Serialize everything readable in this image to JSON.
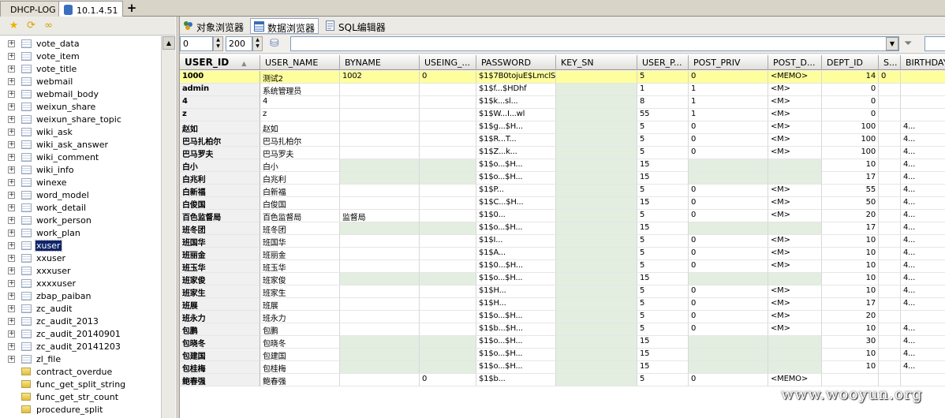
{
  "tabs": {
    "items": [
      {
        "label": "DHCP-LOG",
        "active": false
      },
      {
        "label": "10.1.4.51",
        "active": true
      }
    ],
    "add_label": "+"
  },
  "left_toolbar": {
    "icons": [
      "star-icon",
      "refresh-folder-icon",
      "connections-icon"
    ]
  },
  "tree": {
    "tables": [
      "vote_data",
      "vote_item",
      "vote_title",
      "webmail",
      "webmail_body",
      "weixun_share",
      "weixun_share_topic",
      "wiki_ask",
      "wiki_ask_answer",
      "wiki_comment",
      "wiki_info",
      "winexe",
      "word_model",
      "work_detail",
      "work_person",
      "work_plan",
      "xuser",
      "xxuser",
      "xxxuser",
      "xxxxuser",
      "zbap_paiban",
      "zc_audit",
      "zc_audit_2013",
      "zc_audit_20140901",
      "zc_audit_20141203",
      "zl_file"
    ],
    "selected": "xuser",
    "functions": [
      "contract_overdue",
      "func_get_split_string",
      "func_get_str_count",
      "procedure_split"
    ]
  },
  "right_toolbar": {
    "tabs": [
      {
        "label": "对象浏览器",
        "icon": "object-browser-icon",
        "active": false
      },
      {
        "label": "数据浏览器",
        "icon": "data-browser-icon",
        "active": true
      },
      {
        "label": "SQL编辑器",
        "icon": "sql-editor-icon",
        "active": false
      }
    ]
  },
  "navbar": {
    "offset": "0",
    "limit": "200",
    "filter": "",
    "refresh_icon": "refresh-icon",
    "filter_icon": "funnel-icon"
  },
  "grid": {
    "columns": [
      "USER_ID",
      "USER_NAME",
      "BYNAME",
      "USEING_...",
      "PASSWORD",
      "KEY_SN",
      "USER_P...",
      "POST_PRIV",
      "POST_D...",
      "DEPT_ID",
      "S...",
      "BIRTHDAY"
    ],
    "rows": [
      [
        "1000",
        "测试2",
        "1002",
        "0",
        "$1$7B0tojuE$LmclS",
        "",
        "5",
        "0",
        "<MEMO>",
        "14",
        "0",
        ""
      ],
      [
        "admin",
        "系统管理员",
        "",
        "",
        "$1$f...$HDhf",
        "",
        "1",
        "1",
        "<M>",
        "0",
        "",
        ""
      ],
      [
        "4",
        "4",
        "",
        "",
        "$1$k...sl...",
        "",
        "8",
        "1",
        "<M>",
        "0",
        "",
        ""
      ],
      [
        "z",
        "z",
        "",
        "",
        "$1$W...I...wl",
        "",
        "55",
        "1",
        "<M>",
        "0",
        "",
        ""
      ],
      [
        "赵如",
        "赵如",
        "",
        "",
        "$1$g...$H...",
        "",
        "5",
        "0",
        "<M>",
        "100",
        "",
        "4..."
      ],
      [
        "巴马扎柏尔",
        "巴马扎柏尔",
        "",
        "",
        "$1$R...T...",
        "",
        "5",
        "0",
        "<M>",
        "100",
        "",
        "4..."
      ],
      [
        "巴马罗夫",
        "巴马罗夫",
        "",
        "",
        "$1$Z...k...",
        "",
        "5",
        "0",
        "<M>",
        "100",
        "",
        "4..."
      ],
      [
        "白小",
        "白小",
        "",
        "",
        "$1$o...$H...",
        "",
        "15",
        "",
        "",
        "10",
        "",
        "4..."
      ],
      [
        "白兆利",
        "白兆利",
        "",
        "",
        "$1$o...$H...",
        "",
        "15",
        "",
        "",
        "17",
        "",
        "4..."
      ],
      [
        "白新福",
        "白新福",
        "",
        "",
        "$1$P...",
        "",
        "5",
        "0",
        "<M>",
        "55",
        "",
        "4..."
      ],
      [
        "白俊国",
        "白俊国",
        "",
        "",
        "$1$C...$H...",
        "",
        "15",
        "0",
        "<M>",
        "50",
        "",
        "4..."
      ],
      [
        "百色监督局",
        "百色监督局",
        "监督局",
        "",
        "$1$0...",
        "",
        "5",
        "0",
        "<M>",
        "20",
        "",
        "4..."
      ],
      [
        "班冬团",
        "班冬团",
        "",
        "",
        "$1$o...$H...",
        "",
        "15",
        "",
        "",
        "17",
        "",
        "4..."
      ],
      [
        "班国华",
        "班国华",
        "",
        "",
        "$1$I...",
        "",
        "5",
        "0",
        "<M>",
        "10",
        "",
        "4..."
      ],
      [
        "班丽金",
        "班丽金",
        "",
        "",
        "$1$A...",
        "",
        "5",
        "0",
        "<M>",
        "10",
        "",
        "4..."
      ],
      [
        "班玉华",
        "班玉华",
        "",
        "",
        "$1$0...$H...",
        "",
        "5",
        "0",
        "<M>",
        "10",
        "",
        "4..."
      ],
      [
        "班家俊",
        "班家俊",
        "",
        "",
        "$1$o...$H...",
        "",
        "15",
        "",
        "",
        "10",
        "",
        "4..."
      ],
      [
        "班家生",
        "班家生",
        "",
        "",
        "$1$H...",
        "",
        "5",
        "0",
        "<M>",
        "10",
        "",
        "4..."
      ],
      [
        "班展",
        "班展",
        "",
        "",
        "$1$H...",
        "",
        "5",
        "0",
        "<M>",
        "17",
        "",
        "4..."
      ],
      [
        "班永力",
        "班永力",
        "",
        "",
        "$1$o...$H...",
        "",
        "5",
        "0",
        "<M>",
        "20",
        "",
        ""
      ],
      [
        "包鹏",
        "包鹏",
        "",
        "",
        "$1$b...$H...",
        "",
        "5",
        "0",
        "<M>",
        "10",
        "",
        "4..."
      ],
      [
        "包晓冬",
        "包晓冬",
        "",
        "",
        "$1$o...$H...",
        "",
        "15",
        "",
        "",
        "30",
        "",
        "4..."
      ],
      [
        "包建国",
        "包建国",
        "",
        "",
        "$1$o...$H...",
        "",
        "15",
        "",
        "",
        "10",
        "",
        "4..."
      ],
      [
        "包桂梅",
        "包桂梅",
        "",
        "",
        "$1$o...$H...",
        "",
        "15",
        "",
        "",
        "10",
        "",
        "4..."
      ],
      [
        "鲍春强",
        "鲍春强",
        "",
        "0",
        "$1$b...",
        "",
        "5",
        "0",
        "<MEMO>",
        "",
        "",
        ""
      ]
    ]
  },
  "watermark": "www.wooyun.org"
}
